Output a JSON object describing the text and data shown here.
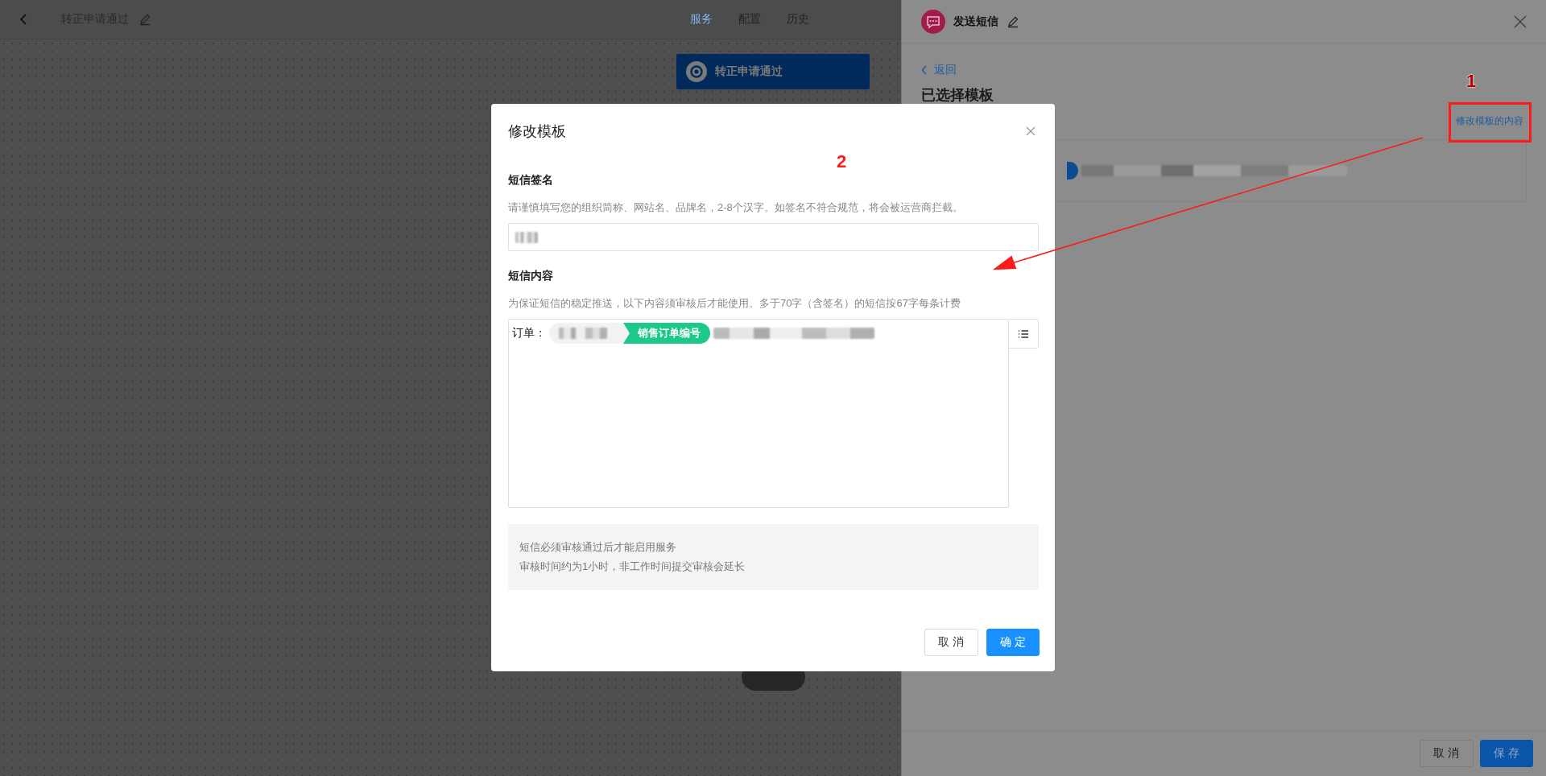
{
  "editor": {
    "title": "转正申请通过",
    "tabs": [
      {
        "label": "服务",
        "selected": true
      },
      {
        "label": "配置",
        "selected": false
      },
      {
        "label": "历史",
        "selected": false
      }
    ],
    "node": {
      "label": "转正申请通过"
    }
  },
  "drawer": {
    "title": "发送短信",
    "back_link": "返回",
    "heading": "已选择模板",
    "edit_link": "修改模板的内容",
    "buttons": [
      {
        "label": "取消",
        "kind": "default"
      },
      {
        "label": "保存",
        "kind": "primary"
      }
    ]
  },
  "modal": {
    "title": "修改模板",
    "sections": [
      {
        "label": "短信签名",
        "hint": "请谨慎填写您的组织简称、网站名、品牌名，2-8个汉字。如签名不符合规范，将会被运营商拦截。",
        "kind": "input"
      },
      {
        "label": "短信内容",
        "hint": "为保证短信的稳定推送，以下内容须审核后才能使用。多于70字（含签名）的短信按67字每条计费",
        "kind": "editor"
      }
    ],
    "content_prefix": "订单：",
    "variable_tag": "销售订单编号",
    "notice": [
      "短信必须审核通过后才能启用服务",
      "审核时间约为1小时，非工作时间提交审核会延长"
    ],
    "buttons": [
      {
        "label": "取消",
        "kind": "default"
      },
      {
        "label": "确定",
        "kind": "primary"
      }
    ]
  },
  "annotations": [
    {
      "label": "1"
    },
    {
      "label": "2"
    }
  ]
}
